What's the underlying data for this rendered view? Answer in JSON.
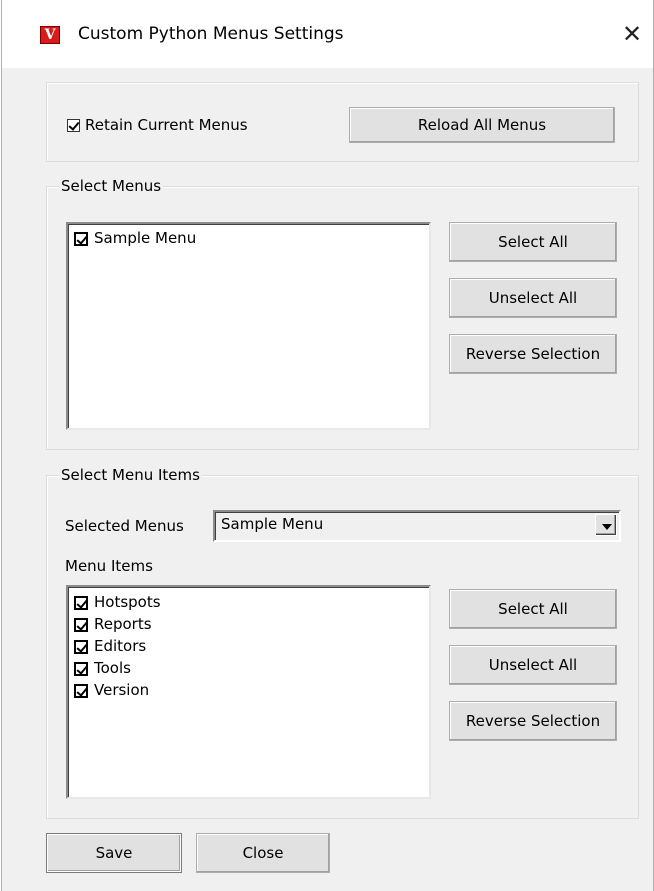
{
  "window": {
    "title": "Custom Python Menus Settings",
    "app_icon_glyph": "V",
    "close_glyph": "✕"
  },
  "options": {
    "retain_label": "Retain Current Menus",
    "retain_checked": true,
    "reload_label": "Reload All Menus"
  },
  "select_menus": {
    "group_label": "Select Menus",
    "items": [
      {
        "label": "Sample Menu",
        "checked": true
      }
    ],
    "select_all": "Select All",
    "unselect_all": "Unselect All",
    "reverse_selection": "Reverse Selection"
  },
  "select_menu_items": {
    "group_label": "Select Menu Items",
    "selected_menus_label": "Selected Menus",
    "selected_menus_value": "Sample Menu",
    "menu_items_label": "Menu Items",
    "items": [
      {
        "label": "Hotspots",
        "checked": true
      },
      {
        "label": "Reports",
        "checked": true
      },
      {
        "label": "Editors",
        "checked": true
      },
      {
        "label": "Tools",
        "checked": true
      },
      {
        "label": "Version",
        "checked": true
      }
    ],
    "select_all": "Select All",
    "unselect_all": "Unselect All",
    "reverse_selection": "Reverse Selection"
  },
  "footer": {
    "save": "Save",
    "close": "Close"
  },
  "colors": {
    "window_bg": "#f0f0f0",
    "icon_red": "#d81c1c"
  }
}
